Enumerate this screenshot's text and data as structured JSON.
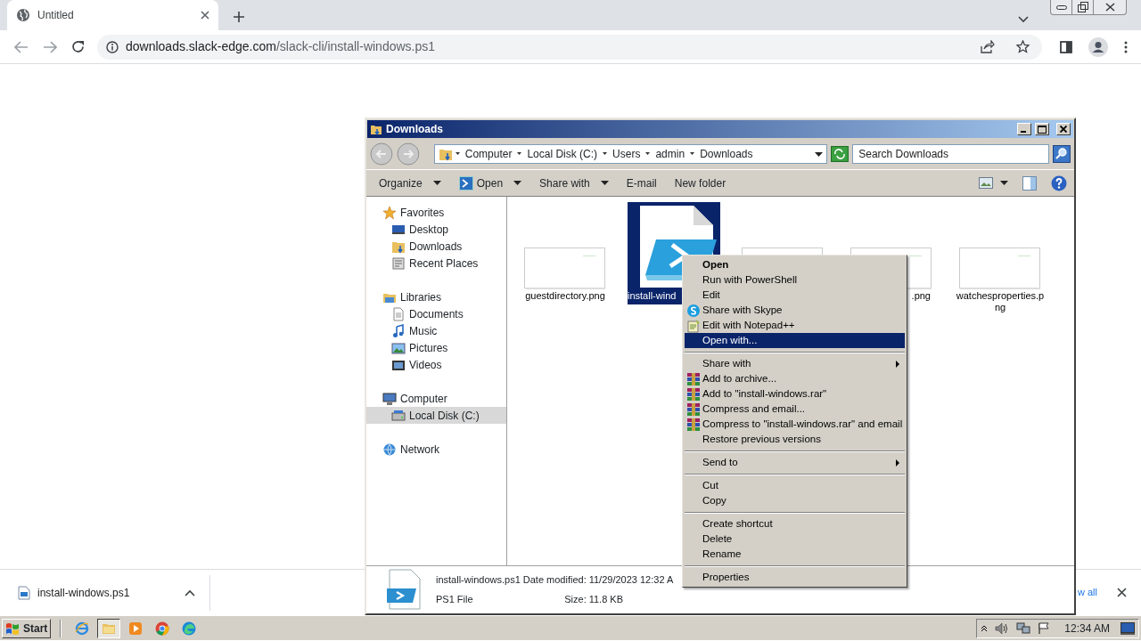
{
  "browser": {
    "tab": {
      "title": "Untitled",
      "selected": true
    },
    "url": {
      "host": "downloads.slack-edge.com",
      "path": "/slack-cli/install-windows.ps1"
    }
  },
  "explorer": {
    "title": "Downloads",
    "breadcrumb": [
      "Computer",
      "Local Disk (C:)",
      "Users",
      "admin",
      "Downloads"
    ],
    "search": {
      "placeholder": "Search Downloads"
    },
    "toolbar": [
      {
        "label": "Organize",
        "kind": "text",
        "dropdown": true
      },
      {
        "label": "Open",
        "kind": "icon",
        "dropdown": true
      },
      {
        "label": "Share with",
        "kind": "text",
        "dropdown": true
      },
      {
        "label": "E-mail",
        "kind": "text",
        "dropdown": false
      },
      {
        "label": "New folder",
        "kind": "text",
        "dropdown": false
      }
    ],
    "nav": [
      {
        "label": "Favorites",
        "kind": "star",
        "selected": false,
        "children": [
          {
            "label": "Desktop",
            "kind": "desktop",
            "selected": false
          },
          {
            "label": "Downloads",
            "kind": "folder",
            "selected": false
          },
          {
            "label": "Recent Places",
            "kind": "places",
            "selected": false
          }
        ]
      },
      {
        "label": "Libraries",
        "kind": "library",
        "selected": false,
        "children": [
          {
            "label": "Documents",
            "kind": "document",
            "selected": false
          },
          {
            "label": "Music",
            "kind": "music",
            "selected": false
          },
          {
            "label": "Pictures",
            "kind": "picture",
            "selected": false
          },
          {
            "label": "Videos",
            "kind": "video",
            "selected": false
          }
        ]
      },
      {
        "label": "Computer",
        "kind": "computer",
        "selected": false,
        "children": [
          {
            "label": "Local Disk (C:)",
            "kind": "disk",
            "selected": true
          }
        ]
      },
      {
        "label": "Network",
        "kind": "network",
        "selected": false
      }
    ],
    "files": [
      {
        "name": "guestdirectory.png",
        "kind": "image",
        "selected": false,
        "cut_left": false,
        "cut_right": false
      },
      {
        "name": "install-wind",
        "kind": "script",
        "selected": true,
        "cut_left": false,
        "cut_right": true
      },
      {
        "kind": "image",
        "selected": false
      },
      {
        "name": ".png",
        "kind": "image",
        "selected": false,
        "cut_left": true,
        "cut_right": false
      },
      {
        "name": "watchesproperties.png",
        "kind": "image",
        "selected": false,
        "cut_left": false,
        "cut_right": false
      }
    ],
    "details": {
      "name": "install-windows.ps1",
      "type": "PS1 File",
      "date_label": "Date modified:",
      "date": "11/29/2023 12:32 A",
      "size_label": "Size:",
      "size": "11.8 KB"
    }
  },
  "context_menu": [
    {
      "kind": "item",
      "label": "Open",
      "default": true,
      "selected": false,
      "submenu": false
    },
    {
      "kind": "item",
      "label": "Run with PowerShell",
      "default": false,
      "selected": false,
      "submenu": false
    },
    {
      "kind": "item",
      "label": "Edit",
      "default": false,
      "selected": false,
      "submenu": false
    },
    {
      "kind": "skype",
      "label": "Share with Skype",
      "default": false,
      "selected": false,
      "submenu": false
    },
    {
      "kind": "notepad",
      "label": "Edit with Notepad++",
      "default": false,
      "selected": false,
      "submenu": false
    },
    {
      "kind": "item",
      "label": "Open with...",
      "default": false,
      "selected": true,
      "submenu": false
    },
    {
      "kind": "separator"
    },
    {
      "kind": "item",
      "label": "Share with",
      "default": false,
      "selected": false,
      "submenu": true
    },
    {
      "kind": "archive",
      "label": "Add to archive...",
      "default": false,
      "selected": false,
      "submenu": false
    },
    {
      "kind": "archive",
      "label": "Add to \"install-windows.rar\"",
      "default": false,
      "selected": false,
      "submenu": false
    },
    {
      "kind": "archive",
      "label": "Compress and email...",
      "default": false,
      "selected": false,
      "submenu": false
    },
    {
      "kind": "archive",
      "label": "Compress to \"install-windows.rar\" and email",
      "default": false,
      "selected": false,
      "submenu": false
    },
    {
      "kind": "item",
      "label": "Restore previous versions",
      "default": false,
      "selected": false,
      "submenu": false
    },
    {
      "kind": "separator"
    },
    {
      "kind": "item",
      "label": "Send to",
      "default": false,
      "selected": false,
      "submenu": true
    },
    {
      "kind": "separator"
    },
    {
      "kind": "item",
      "label": "Cut",
      "default": false,
      "selected": false,
      "submenu": false
    },
    {
      "kind": "item",
      "label": "Copy",
      "default": false,
      "selected": false,
      "submenu": false
    },
    {
      "kind": "separator"
    },
    {
      "kind": "item",
      "label": "Create shortcut",
      "default": false,
      "selected": false,
      "submenu": false
    },
    {
      "kind": "item",
      "label": "Delete",
      "default": false,
      "selected": false,
      "submenu": false
    },
    {
      "kind": "item",
      "label": "Rename",
      "default": false,
      "selected": false,
      "submenu": false
    },
    {
      "kind": "separator"
    },
    {
      "kind": "item",
      "label": "Properties",
      "default": false,
      "selected": false,
      "submenu": false
    }
  ],
  "download_bar": {
    "file": "install-windows.ps1",
    "show_all": "w all"
  },
  "taskbar": {
    "start": "Start",
    "apps": [
      {
        "kind": "ie",
        "selected": false
      },
      {
        "kind": "explorer",
        "selected": true
      },
      {
        "kind": "media",
        "selected": false
      },
      {
        "kind": "chrome",
        "selected": false
      },
      {
        "kind": "edge",
        "selected": false
      }
    ],
    "clock": "12:34 AM"
  }
}
